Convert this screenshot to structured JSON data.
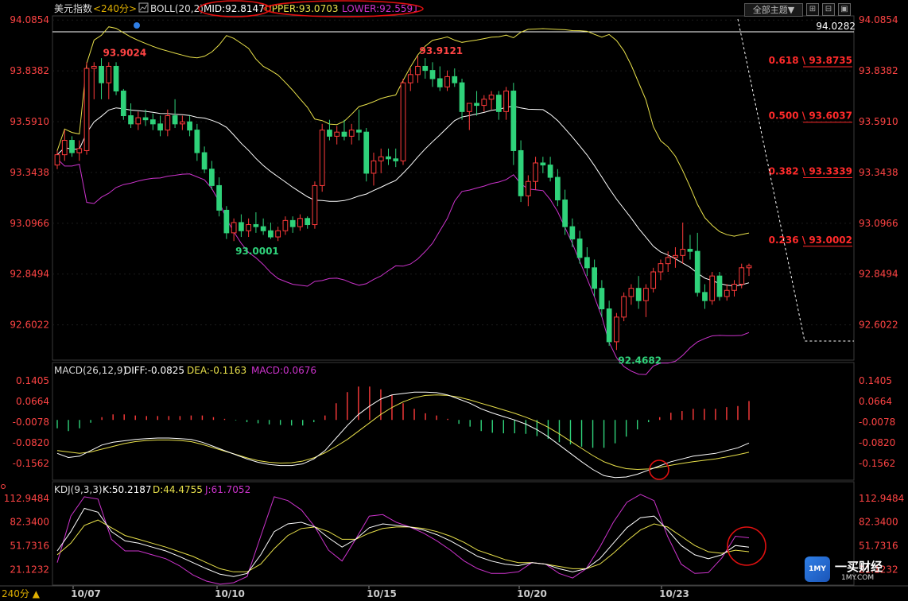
{
  "header": {
    "title": "美元指数",
    "period": "<240分>",
    "indicator": "BOLL(20,2)",
    "mid": "MID:92.8147",
    "upper": "UPPER:93.0703",
    "lower": "LOWER:92.5591",
    "theme_button": "全部主题▼",
    "window_buttons": [
      "⊞",
      "⊟",
      "▣",
      "✕"
    ]
  },
  "macd_header": {
    "name": "MACD(26,12,9)",
    "diff": "DIFF:-0.0825",
    "dea": "DEA:-0.1163",
    "macd": "MACD:0.0676"
  },
  "kdj_header": {
    "name": "KDJ(9,3,3)",
    "k": "K:50.2187",
    "d": "D:44.4755",
    "j": "J:61.7052"
  },
  "period_label": "240分 ▲",
  "watermark": {
    "badge": "1MY",
    "name": "一买财经",
    "url": "1MY.COM"
  },
  "colors": {
    "up": "#ff3b3b",
    "down": "#2fd27a",
    "mid": "#ffffff",
    "upper": "#e8e04a",
    "lower": "#cc33cc",
    "axis_text": "#ff4444",
    "fib": "#ff2a2a"
  },
  "chart_data": [
    {
      "type": "candlestick",
      "ylim": [
        92.45,
        94.09
      ],
      "y_ticks": [
        "94.0854",
        "93.8382",
        "93.5910",
        "93.3438",
        "93.0966",
        "92.8494",
        "92.6022"
      ],
      "x_ticks": [
        "10/07",
        "10/10",
        "10/15",
        "10/20",
        "10/23"
      ],
      "price_line": "94.0282",
      "annotations": [
        {
          "text": "93.9024",
          "value": 93.9024,
          "color": "#ff4444"
        },
        {
          "text": "93.0001",
          "value": 93.0001,
          "color": "#2fd27a"
        },
        {
          "text": "93.9121",
          "value": 93.9121,
          "color": "#ff4444"
        },
        {
          "text": "92.4682",
          "value": 92.4682,
          "color": "#2fd27a"
        }
      ],
      "fibonacci": [
        {
          "label": "0.618 \\ 93.8735",
          "value": 93.8735
        },
        {
          "label": "0.500 \\ 93.6037",
          "value": 93.6037
        },
        {
          "label": "0.382 \\ 93.3339",
          "value": 93.3339
        },
        {
          "label": "0.236 \\ 93.0002",
          "value": 93.0002
        }
      ],
      "ohlc": [
        [
          93.38,
          93.45,
          93.36,
          93.43
        ],
        [
          93.43,
          93.55,
          93.4,
          93.5
        ],
        [
          93.5,
          93.52,
          93.42,
          93.44
        ],
        [
          93.44,
          93.5,
          93.4,
          93.46
        ],
        [
          93.45,
          93.88,
          93.43,
          93.85
        ],
        [
          93.85,
          93.88,
          93.7,
          93.86
        ],
        [
          93.86,
          93.9,
          93.7,
          93.78
        ],
        [
          93.78,
          93.88,
          93.7,
          93.86
        ],
        [
          93.86,
          93.88,
          93.72,
          93.74
        ],
        [
          93.74,
          93.75,
          93.6,
          93.62
        ],
        [
          93.62,
          93.68,
          93.56,
          93.58
        ],
        [
          93.58,
          93.64,
          93.55,
          93.61
        ],
        [
          93.61,
          93.65,
          93.57,
          93.6
        ],
        [
          93.6,
          93.63,
          93.55,
          93.58
        ],
        [
          93.58,
          93.62,
          93.52,
          93.55
        ],
        [
          93.55,
          93.65,
          93.52,
          93.62
        ],
        [
          93.62,
          93.7,
          93.56,
          93.58
        ],
        [
          93.58,
          93.62,
          93.55,
          93.59
        ],
        [
          93.59,
          93.62,
          93.52,
          93.55
        ],
        [
          93.55,
          93.58,
          93.4,
          93.44
        ],
        [
          93.44,
          93.47,
          93.34,
          93.36
        ],
        [
          93.36,
          93.4,
          93.26,
          93.28
        ],
        [
          93.28,
          93.32,
          93.13,
          93.16
        ],
        [
          93.16,
          93.18,
          93.02,
          93.05
        ],
        [
          93.05,
          93.12,
          93.01,
          93.1
        ],
        [
          93.1,
          93.14,
          93.03,
          93.06
        ],
        [
          93.06,
          93.12,
          93.03,
          93.09
        ],
        [
          93.09,
          93.15,
          93.05,
          93.08
        ],
        [
          93.08,
          93.12,
          93.04,
          93.06
        ],
        [
          93.06,
          93.1,
          93.02,
          93.03
        ],
        [
          93.03,
          93.08,
          93.01,
          93.06
        ],
        [
          93.06,
          93.13,
          93.04,
          93.11
        ],
        [
          93.11,
          93.13,
          93.05,
          93.08
        ],
        [
          93.08,
          93.14,
          93.06,
          93.12
        ],
        [
          93.12,
          93.13,
          93.07,
          93.09
        ],
        [
          93.09,
          93.3,
          93.07,
          93.28
        ],
        [
          93.28,
          93.58,
          93.25,
          93.55
        ],
        [
          93.55,
          93.6,
          93.5,
          93.52
        ],
        [
          93.52,
          93.57,
          93.48,
          93.54
        ],
        [
          93.54,
          93.6,
          93.5,
          93.52
        ],
        [
          93.52,
          93.58,
          93.48,
          93.55
        ],
        [
          93.55,
          93.65,
          93.5,
          93.54
        ],
        [
          93.54,
          93.56,
          93.3,
          93.34
        ],
        [
          93.34,
          93.44,
          93.28,
          93.4
        ],
        [
          93.4,
          93.46,
          93.34,
          93.42
        ],
        [
          93.42,
          93.46,
          93.38,
          93.41
        ],
        [
          93.41,
          93.46,
          93.37,
          93.4
        ],
        [
          93.4,
          93.8,
          93.38,
          93.78
        ],
        [
          93.78,
          93.85,
          93.74,
          93.82
        ],
        [
          93.82,
          93.91,
          93.78,
          93.86
        ],
        [
          93.86,
          93.9,
          93.8,
          93.84
        ],
        [
          93.84,
          93.88,
          93.76,
          93.8
        ],
        [
          93.8,
          93.86,
          93.74,
          93.76
        ],
        [
          93.76,
          93.84,
          93.74,
          93.81
        ],
        [
          93.81,
          93.85,
          93.76,
          93.78
        ],
        [
          93.78,
          93.8,
          93.6,
          93.64
        ],
        [
          93.64,
          93.68,
          93.55,
          93.68
        ],
        [
          93.68,
          93.74,
          93.62,
          93.67
        ],
        [
          93.67,
          93.72,
          93.64,
          93.7
        ],
        [
          93.7,
          93.74,
          93.65,
          93.72
        ],
        [
          93.72,
          93.74,
          93.6,
          93.64
        ],
        [
          93.64,
          93.76,
          93.6,
          93.74
        ],
        [
          93.74,
          93.78,
          93.38,
          93.45
        ],
        [
          93.45,
          93.5,
          93.2,
          93.23
        ],
        [
          93.23,
          93.33,
          93.18,
          93.3
        ],
        [
          93.3,
          93.42,
          93.26,
          93.39
        ],
        [
          93.39,
          93.42,
          93.34,
          93.38
        ],
        [
          93.38,
          93.42,
          93.3,
          93.32
        ],
        [
          93.32,
          93.36,
          93.18,
          93.21
        ],
        [
          93.21,
          93.26,
          93.04,
          93.08
        ],
        [
          93.08,
          93.12,
          92.98,
          93.02
        ],
        [
          93.02,
          93.06,
          92.9,
          92.93
        ],
        [
          92.93,
          92.98,
          92.84,
          92.88
        ],
        [
          92.88,
          92.92,
          92.74,
          92.78
        ],
        [
          92.78,
          92.82,
          92.64,
          92.68
        ],
        [
          92.68,
          92.72,
          92.5,
          92.52
        ],
        [
          92.52,
          92.66,
          92.48,
          92.64
        ],
        [
          92.64,
          92.76,
          92.62,
          92.74
        ],
        [
          92.74,
          92.8,
          92.7,
          92.78
        ],
        [
          92.78,
          92.84,
          92.68,
          92.72
        ],
        [
          92.72,
          92.8,
          92.64,
          92.78
        ],
        [
          92.78,
          92.88,
          92.76,
          92.86
        ],
        [
          92.86,
          92.92,
          92.82,
          92.9
        ],
        [
          92.9,
          92.96,
          92.86,
          92.93
        ],
        [
          92.93,
          92.98,
          92.88,
          92.94
        ],
        [
          92.94,
          93.1,
          92.9,
          92.97
        ],
        [
          92.97,
          93.04,
          92.92,
          92.96
        ],
        [
          92.96,
          93.05,
          92.74,
          92.76
        ],
        [
          92.76,
          92.8,
          92.68,
          92.72
        ],
        [
          92.72,
          92.86,
          92.7,
          92.84
        ],
        [
          92.84,
          92.86,
          92.72,
          92.74
        ],
        [
          92.74,
          92.8,
          92.72,
          92.77
        ],
        [
          92.77,
          92.82,
          92.74,
          92.8
        ],
        [
          92.8,
          92.9,
          92.78,
          92.88
        ],
        [
          92.88,
          92.9,
          92.84,
          92.89
        ]
      ]
    },
    {
      "type": "macd",
      "ylim": [
        -0.205,
        0.155
      ],
      "y_ticks": [
        "0.1405",
        "0.0664",
        "-0.0078",
        "-0.0820",
        "-0.1562"
      ],
      "diff": [
        -0.12,
        -0.135,
        -0.13,
        -0.11,
        -0.09,
        -0.08,
        -0.075,
        -0.07,
        -0.067,
        -0.065,
        -0.065,
        -0.067,
        -0.07,
        -0.08,
        -0.095,
        -0.11,
        -0.125,
        -0.14,
        -0.152,
        -0.16,
        -0.164,
        -0.164,
        -0.158,
        -0.14,
        -0.11,
        -0.065,
        -0.02,
        0.02,
        0.05,
        0.075,
        0.09,
        0.095,
        0.1,
        0.1,
        0.098,
        0.09,
        0.075,
        0.06,
        0.04,
        0.025,
        0.012,
        0.0,
        -0.015,
        -0.035,
        -0.06,
        -0.09,
        -0.12,
        -0.15,
        -0.178,
        -0.2,
        -0.207,
        -0.205,
        -0.195,
        -0.18,
        -0.165,
        -0.15,
        -0.14,
        -0.13,
        -0.125,
        -0.12,
        -0.11,
        -0.1,
        -0.083
      ],
      "dea": [
        -0.11,
        -0.115,
        -0.12,
        -0.115,
        -0.105,
        -0.095,
        -0.085,
        -0.078,
        -0.074,
        -0.072,
        -0.072,
        -0.074,
        -0.078,
        -0.088,
        -0.1,
        -0.112,
        -0.124,
        -0.136,
        -0.146,
        -0.152,
        -0.155,
        -0.154,
        -0.148,
        -0.136,
        -0.118,
        -0.095,
        -0.07,
        -0.04,
        -0.01,
        0.02,
        0.045,
        0.065,
        0.08,
        0.088,
        0.09,
        0.088,
        0.082,
        0.072,
        0.06,
        0.048,
        0.036,
        0.024,
        0.01,
        -0.006,
        -0.026,
        -0.05,
        -0.076,
        -0.102,
        -0.128,
        -0.15,
        -0.165,
        -0.175,
        -0.178,
        -0.176,
        -0.17,
        -0.163,
        -0.156,
        -0.15,
        -0.145,
        -0.14,
        -0.133,
        -0.125,
        -0.116
      ],
      "histogram": [
        -0.03,
        -0.04,
        -0.03,
        -0.01,
        0.01,
        0.02,
        0.02,
        0.016,
        0.014,
        0.014,
        0.014,
        0.014,
        0.016,
        0.016,
        0.01,
        0.004,
        -0.002,
        -0.008,
        -0.012,
        -0.016,
        -0.018,
        -0.02,
        -0.02,
        -0.008,
        0.016,
        0.06,
        0.1,
        0.12,
        0.12,
        0.11,
        0.09,
        0.06,
        0.04,
        0.024,
        0.016,
        0.004,
        -0.014,
        -0.024,
        -0.04,
        -0.046,
        -0.048,
        -0.048,
        -0.05,
        -0.058,
        -0.068,
        -0.08,
        -0.088,
        -0.096,
        -0.1,
        -0.1,
        -0.084,
        -0.06,
        -0.034,
        -0.008,
        0.01,
        0.026,
        0.032,
        0.04,
        0.04,
        0.04,
        0.046,
        0.05,
        0.068
      ]
    },
    {
      "type": "kdj",
      "ylim": [
        5,
        120
      ],
      "y_ticks": [
        "112.9484",
        "82.3400",
        "51.7316",
        "21.1232"
      ],
      "k": [
        45,
        70,
        100,
        95,
        70,
        58,
        55,
        50,
        45,
        38,
        30,
        22,
        15,
        12,
        16,
        40,
        70,
        80,
        82,
        76,
        62,
        50,
        60,
        75,
        80,
        78,
        76,
        72,
        66,
        58,
        48,
        38,
        32,
        28,
        26,
        30,
        28,
        22,
        18,
        22,
        35,
        55,
        75,
        88,
        90,
        72,
        52,
        40,
        35,
        40,
        52,
        50
      ],
      "d": [
        40,
        55,
        78,
        85,
        75,
        65,
        60,
        55,
        50,
        44,
        38,
        30,
        22,
        18,
        18,
        28,
        48,
        65,
        74,
        76,
        70,
        60,
        60,
        68,
        74,
        76,
        76,
        74,
        70,
        64,
        56,
        46,
        40,
        34,
        30,
        30,
        28,
        25,
        22,
        22,
        28,
        42,
        58,
        72,
        80,
        76,
        64,
        52,
        44,
        42,
        46,
        44
      ],
      "j": [
        30,
        90,
        115,
        112,
        60,
        45,
        45,
        40,
        35,
        26,
        14,
        6,
        2,
        4,
        12,
        64,
        115,
        110,
        98,
        76,
        46,
        32,
        60,
        90,
        92,
        82,
        76,
        68,
        58,
        46,
        32,
        22,
        16,
        16,
        18,
        30,
        28,
        16,
        10,
        22,
        50,
        82,
        108,
        118,
        110,
        64,
        28,
        16,
        17,
        36,
        64,
        62
      ]
    }
  ]
}
